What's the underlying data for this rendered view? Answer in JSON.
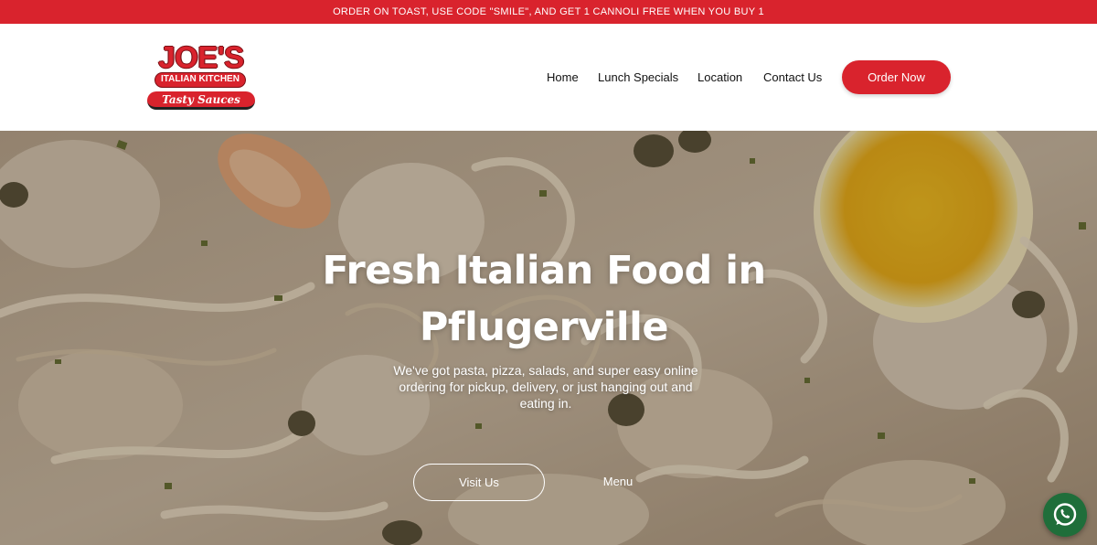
{
  "promo": {
    "text": "ORDER ON TOAST, USE CODE \"SMILE\", AND GET 1 CANNOLI FREE WHEN YOU BUY 1"
  },
  "logo": {
    "name": "JOE'S",
    "line2": "ITALIAN KITCHEN",
    "tagline": "Tasty Sauces"
  },
  "nav": {
    "items": [
      {
        "label": "Home"
      },
      {
        "label": "Lunch Specials"
      },
      {
        "label": "Location"
      },
      {
        "label": "Contact Us"
      }
    ],
    "cta_label": "Order Now"
  },
  "hero": {
    "title": "Fresh Italian Food in Pflugerville",
    "subtitle": "We've got pasta, pizza, salads, and super easy online ordering for pickup, delivery, or just hanging out and eating in.",
    "primary_button": "Visit Us",
    "secondary_link": "Menu",
    "image": "pasta-with-chicken-and-lemon-photo"
  },
  "floating": {
    "icon": "whatsapp-icon"
  },
  "colors": {
    "brand_red": "#d9232d",
    "whatsapp_green": "#1f6e3a",
    "text_dark": "#111111"
  }
}
